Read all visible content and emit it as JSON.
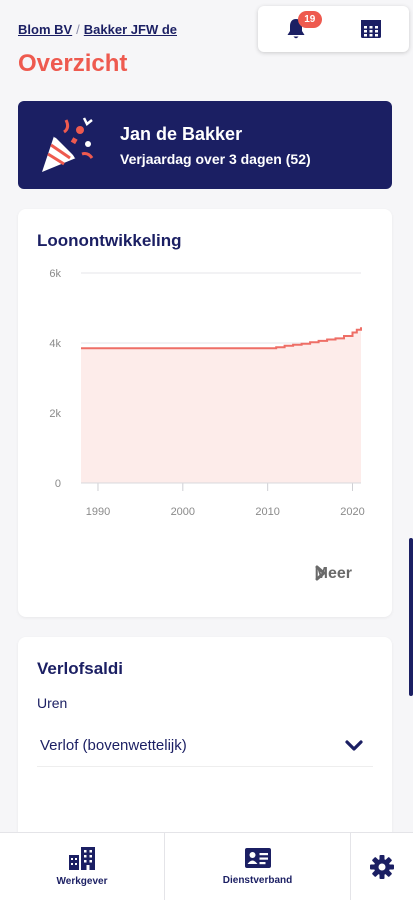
{
  "breadcrumb": {
    "company": "Blom BV",
    "separator": "/",
    "employee": "Bakker JFW de"
  },
  "page_title": "Overzicht",
  "top_actions": {
    "notifications_count": "19",
    "bell_icon": "bell-icon",
    "calendar_icon": "calendar-icon"
  },
  "birthday": {
    "name": "Jan de Bakker",
    "message": "Verjaardag over 3 dagen (52)",
    "icon": "party-popper-icon"
  },
  "loon": {
    "title": "Loonontwikkeling",
    "more_label": "Meer",
    "chart_data": {
      "type": "area",
      "title": "Loonontwikkeling",
      "xlabel": "",
      "ylabel": "",
      "xlim": [
        1988,
        2021
      ],
      "ylim": [
        0,
        6000
      ],
      "y_ticks": [
        0,
        2000,
        4000,
        6000
      ],
      "y_tick_labels": [
        "0",
        "2k",
        "4k",
        "6k"
      ],
      "x_ticks": [
        1990,
        2000,
        2010,
        2020
      ],
      "x_tick_labels": [
        "1990",
        "2000",
        "2010",
        "2020"
      ],
      "grid": true,
      "color": "#ee6e66",
      "fill": "#fdecea",
      "x": [
        1988,
        2010,
        2011,
        2012,
        2013,
        2014,
        2015,
        2016,
        2017,
        2018,
        2019,
        2020,
        2020.5,
        2021
      ],
      "values": [
        3850,
        3850,
        3880,
        3920,
        3950,
        3980,
        4020,
        4060,
        4100,
        4130,
        4200,
        4300,
        4380,
        4450
      ]
    }
  },
  "verlof": {
    "title": "Verlofsaldi",
    "unit_label": "Uren",
    "selected": "Verlof (bovenwettelijk)",
    "chevron_icon": "chevron-down-icon"
  },
  "bottom_nav": {
    "werkgever": "Werkgever",
    "dienstverband": "Dienstverband",
    "settings_icon": "gear-icon"
  },
  "colors": {
    "navy": "#1b1f63",
    "accent": "#ee5a4f"
  }
}
